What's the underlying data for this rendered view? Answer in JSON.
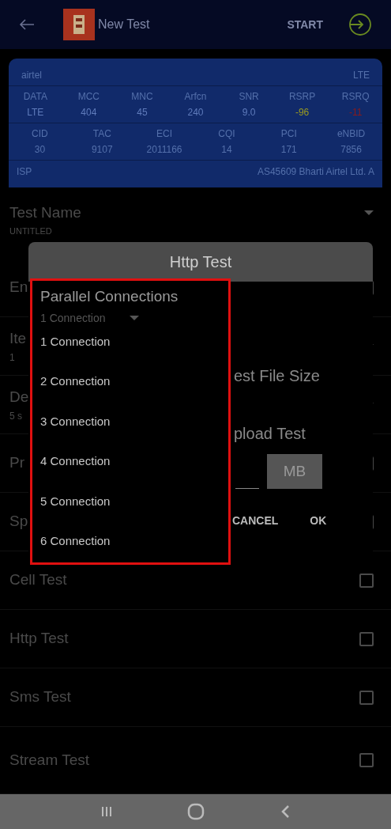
{
  "header": {
    "title": "New Test",
    "action": "START"
  },
  "network": {
    "operator": "airtel",
    "technology": "LTE",
    "row_1": [
      {
        "label": "DATA",
        "value": "LTE",
        "color": "#5f7bbb"
      },
      {
        "label": "MCC",
        "value": "404",
        "color": "#5f7bbb"
      },
      {
        "label": "MNC",
        "value": "45",
        "color": "#5f7bbb"
      },
      {
        "label": "Arfcn",
        "value": "240",
        "color": "#5f7bbb"
      },
      {
        "label": "SNR",
        "value": "9.0",
        "color": "#5f7bbb"
      },
      {
        "label": "RSRP",
        "value": "-96",
        "color": "#9a9a20"
      },
      {
        "label": "RSRQ",
        "value": "-11",
        "color": "#8a1a1a"
      }
    ],
    "row_2": [
      {
        "label": "CID",
        "value": "30"
      },
      {
        "label": "TAC",
        "value": "9107"
      },
      {
        "label": "ECI",
        "value": "2011166"
      },
      {
        "label": "CQI",
        "value": "14"
      },
      {
        "label": "PCI",
        "value": "171"
      },
      {
        "label": "eNBID",
        "value": "7856"
      }
    ],
    "isp_label": "ISP",
    "isp_value": "AS45609 Bharti Airtel Ltd. A"
  },
  "test_name": {
    "label": "Test Name",
    "value": "UNTITLED"
  },
  "rows": [
    {
      "kind": "check",
      "label": "En",
      "checked": false
    },
    {
      "kind": "select",
      "label": "Ite",
      "value": "1"
    },
    {
      "kind": "select",
      "label": "De",
      "value": "5 s"
    },
    {
      "kind": "check",
      "label": "Pr",
      "checked": false
    },
    {
      "kind": "check",
      "label": "Sp",
      "checked": false
    },
    {
      "kind": "check",
      "label": "Cell Test",
      "checked": false
    },
    {
      "kind": "check",
      "label": "Http Test",
      "checked": false
    },
    {
      "kind": "check",
      "label": "Sms Test",
      "checked": false
    },
    {
      "kind": "check",
      "label": "Stream Test",
      "checked": false
    }
  ],
  "dialog": {
    "title": "Http Test",
    "file_size_label": "est File Size",
    "upload_label": "pload Test",
    "unit": "MB",
    "buttons": [
      "CANCEL",
      "OK"
    ]
  },
  "dropdown": {
    "label": "Parallel Connections",
    "value": "1 Connection",
    "options": [
      "1 Connection",
      "2 Connection",
      "3 Connection",
      "4 Connection",
      "5 Connection",
      "6 Connection"
    ]
  }
}
